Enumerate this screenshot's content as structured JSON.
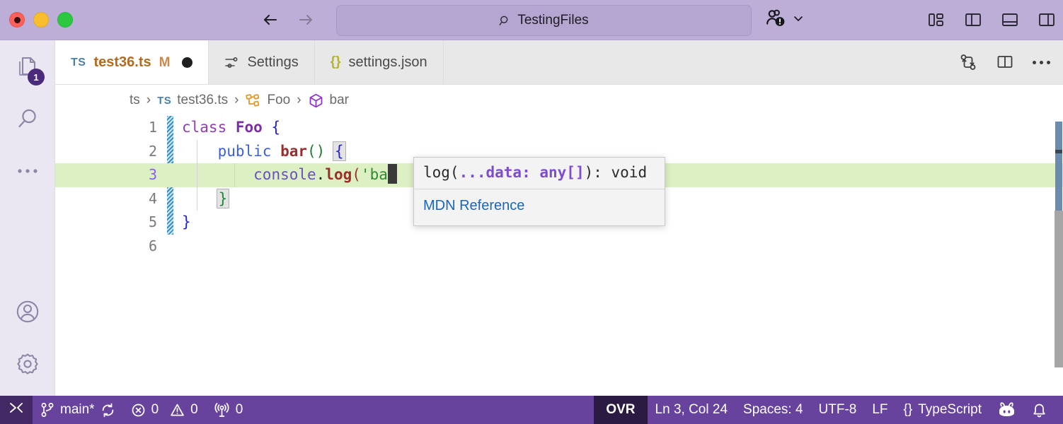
{
  "titlebar": {
    "traffic": {
      "close": "close-window",
      "minimize": "minimize-window",
      "maximize": "maximize-window"
    },
    "back_label": "Go Back",
    "forward_label": "Go Forward",
    "quick_input": {
      "value": "TestingFiles",
      "icon": "search-icon"
    },
    "account": {
      "icon": "accounts-warning-icon",
      "chevron": "chevron-down-icon"
    },
    "layout": [
      {
        "name": "customize-layout",
        "icon": "customize-layout-icon"
      },
      {
        "name": "toggle-primary-sidebar",
        "icon": "layout-sidebar-left-icon"
      },
      {
        "name": "toggle-panel",
        "icon": "layout-panel-icon"
      },
      {
        "name": "toggle-secondary-sidebar",
        "icon": "layout-sidebar-right-icon"
      }
    ]
  },
  "activitybar": {
    "items": [
      {
        "name": "explorer",
        "icon": "files-icon",
        "badge": "1"
      },
      {
        "name": "search",
        "icon": "search-icon",
        "badge": ""
      },
      {
        "name": "more-views",
        "icon": "ellipsis-icon",
        "badge": ""
      }
    ],
    "bottom": [
      {
        "name": "accounts",
        "icon": "account-icon"
      },
      {
        "name": "manage-settings",
        "icon": "gear-icon"
      }
    ]
  },
  "tabs": [
    {
      "label": "test36.ts",
      "icon_label": "TS",
      "icon": "typescript-icon",
      "modified_flag": "M",
      "dirty": true,
      "active": true
    },
    {
      "label": "Settings",
      "icon_label": "",
      "icon": "settings-sliders-icon",
      "modified_flag": "",
      "dirty": false,
      "active": false
    },
    {
      "label": "settings.json",
      "icon_label": "{}",
      "icon": "json-icon",
      "modified_flag": "",
      "dirty": false,
      "active": false
    }
  ],
  "editor_actions": [
    {
      "name": "compare-changes",
      "icon": "source-control-compare-icon"
    },
    {
      "name": "split-editor-right",
      "icon": "split-editor-icon"
    },
    {
      "name": "more-actions",
      "icon": "ellipsis-icon"
    }
  ],
  "breadcrumb": [
    {
      "label": "ts",
      "icon": ""
    },
    {
      "label": "test36.ts",
      "icon": "typescript-icon",
      "icon_label": "TS"
    },
    {
      "label": "Foo",
      "icon": "symbol-class-icon"
    },
    {
      "label": "bar",
      "icon": "symbol-method-icon"
    }
  ],
  "breadcrumb_separator": "›",
  "editor": {
    "language": "TypeScript",
    "lines": [
      {
        "number": "1",
        "text": "class Foo {",
        "active": false
      },
      {
        "number": "2",
        "text": "    public bar() {",
        "active": false
      },
      {
        "number": "3",
        "text": "        console.log('ba",
        "active": true
      },
      {
        "number": "4",
        "text": "    }",
        "active": false
      },
      {
        "number": "5",
        "text": "}",
        "active": false
      },
      {
        "number": "6",
        "text": "",
        "active": false
      }
    ],
    "tokens": {
      "l1_class": "class",
      "l1_name": "Foo",
      "l1_brace": "{",
      "l2_modifier": "public",
      "l2_method": "bar",
      "l2_parens": "()",
      "l2_brace": "{",
      "l3_object": "console",
      "l3_dot": ".",
      "l3_member": "log",
      "l3_paren": "(",
      "l3_string": "'ba",
      "l4_brace": "}",
      "l5_brace": "}"
    }
  },
  "hover": {
    "signature_plain_1": "log(",
    "signature_highlight_1": "...data: any[]",
    "signature_plain_2": "): void",
    "link": "MDN Reference"
  },
  "statusbar": {
    "remote_icon": "remote-host-icon",
    "branch": "main*",
    "branch_icon": "source-control-branch-icon",
    "sync_icon": "sync-icon",
    "errors": "0",
    "error_icon": "error-circle-icon",
    "warnings": "0",
    "warning_icon": "warning-triangle-icon",
    "ports": "0",
    "ports_icon": "radio-tower-icon",
    "overtype": "OVR",
    "cursor_position": "Ln 3, Col 24",
    "indentation": "Spaces: 4",
    "encoding": "UTF-8",
    "eol": "LF",
    "language_mode": "TypeScript",
    "language_icon": "{}",
    "copilot_icon": "copilot-icon",
    "bell_icon": "bell-icon"
  },
  "colors": {
    "titlebar_bg": "#bcaed6",
    "statusbar_bg": "#68439e",
    "activitybar_bg": "#eae7f2",
    "tabbar_bg": "#e8e8e8",
    "editor_bg": "#ffffff",
    "active_line_bg": "#ddf0c4",
    "badge_bg": "#4b2a7b",
    "link_color": "#1a65c0"
  }
}
